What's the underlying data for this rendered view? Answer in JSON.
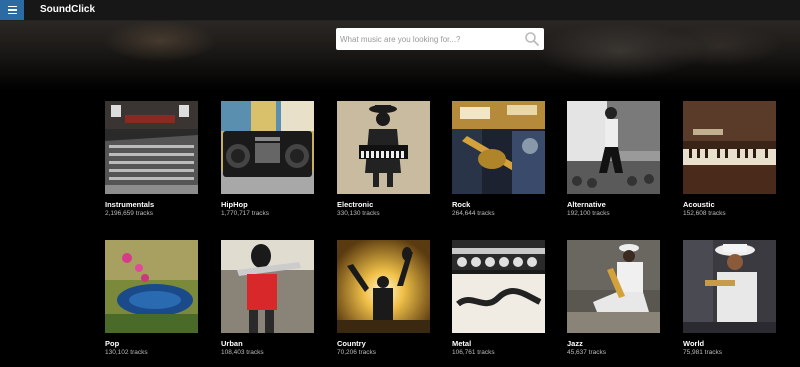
{
  "app": {
    "name": "SoundClick"
  },
  "header": {
    "menu_icon": "hamburger-menu-icon"
  },
  "search": {
    "placeholder": "What music are you looking for...?",
    "value": "",
    "icon": "search-icon"
  },
  "genres": [
    {
      "name": "Instrumentals",
      "count": "2,196,659 tracks"
    },
    {
      "name": "HipHop",
      "count": "1,770,717 tracks"
    },
    {
      "name": "Electronic",
      "count": "330,130 tracks"
    },
    {
      "name": "Rock",
      "count": "264,644 tracks"
    },
    {
      "name": "Alternative",
      "count": "192,100 tracks"
    },
    {
      "name": "Acoustic",
      "count": "152,608 tracks"
    },
    {
      "name": "Pop",
      "count": "130,102 tracks"
    },
    {
      "name": "Urban",
      "count": "108,403 tracks"
    },
    {
      "name": "Country",
      "count": "70,206 tracks"
    },
    {
      "name": "Metal",
      "count": "106,761 tracks"
    },
    {
      "name": "Jazz",
      "count": "45,637 tracks"
    },
    {
      "name": "World",
      "count": "75,981 tracks"
    }
  ],
  "colors": {
    "menu_button": "#2b6aa3",
    "topbar": "#171717",
    "background": "#000000"
  }
}
